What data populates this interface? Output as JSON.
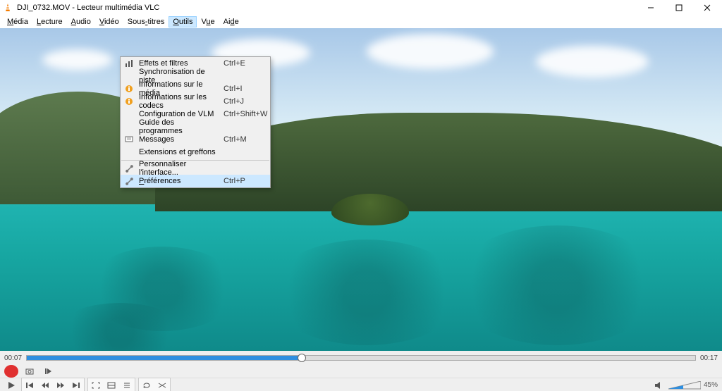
{
  "window": {
    "title": "DJI_0732.MOV - Lecteur multimédia VLC"
  },
  "menubar": {
    "items": [
      {
        "label": "Média",
        "u": 0
      },
      {
        "label": "Lecture",
        "u": 0
      },
      {
        "label": "Audio",
        "u": 0
      },
      {
        "label": "Vidéo",
        "u": 0
      },
      {
        "label": "Sous-titres",
        "u": 4
      },
      {
        "label": "Outils",
        "u": 0,
        "open": true
      },
      {
        "label": "Vue",
        "u": 1
      },
      {
        "label": "Aide",
        "u": 2
      }
    ]
  },
  "tools_menu": {
    "items": [
      {
        "icon": "equalizer",
        "label": "Effets et filtres",
        "shortcut": "Ctrl+E"
      },
      {
        "icon": "",
        "label": "Synchronisation de piste",
        "shortcut": ""
      },
      {
        "icon": "info",
        "label": "Informations sur le média",
        "shortcut": "Ctrl+I"
      },
      {
        "icon": "info",
        "label": "Informations sur les codecs",
        "shortcut": "Ctrl+J"
      },
      {
        "icon": "",
        "label": "Configuration de VLM",
        "shortcut": "Ctrl+Shift+W"
      },
      {
        "icon": "",
        "label": "Guide des programmes",
        "shortcut": ""
      },
      {
        "icon": "msg",
        "label": "Messages",
        "shortcut": "Ctrl+M"
      },
      {
        "icon": "",
        "label": "Extensions et greffons",
        "shortcut": ""
      },
      {
        "sep": true
      },
      {
        "icon": "wrench",
        "label": "Personnaliser l'interface...",
        "shortcut": ""
      },
      {
        "icon": "wrench",
        "label": "Préférences",
        "shortcut": "Ctrl+P",
        "hl": true,
        "u": 0
      }
    ]
  },
  "timeline": {
    "elapsed": "00:07",
    "total": "00:17",
    "progress_pct": 41
  },
  "volume": {
    "label": "45%"
  }
}
